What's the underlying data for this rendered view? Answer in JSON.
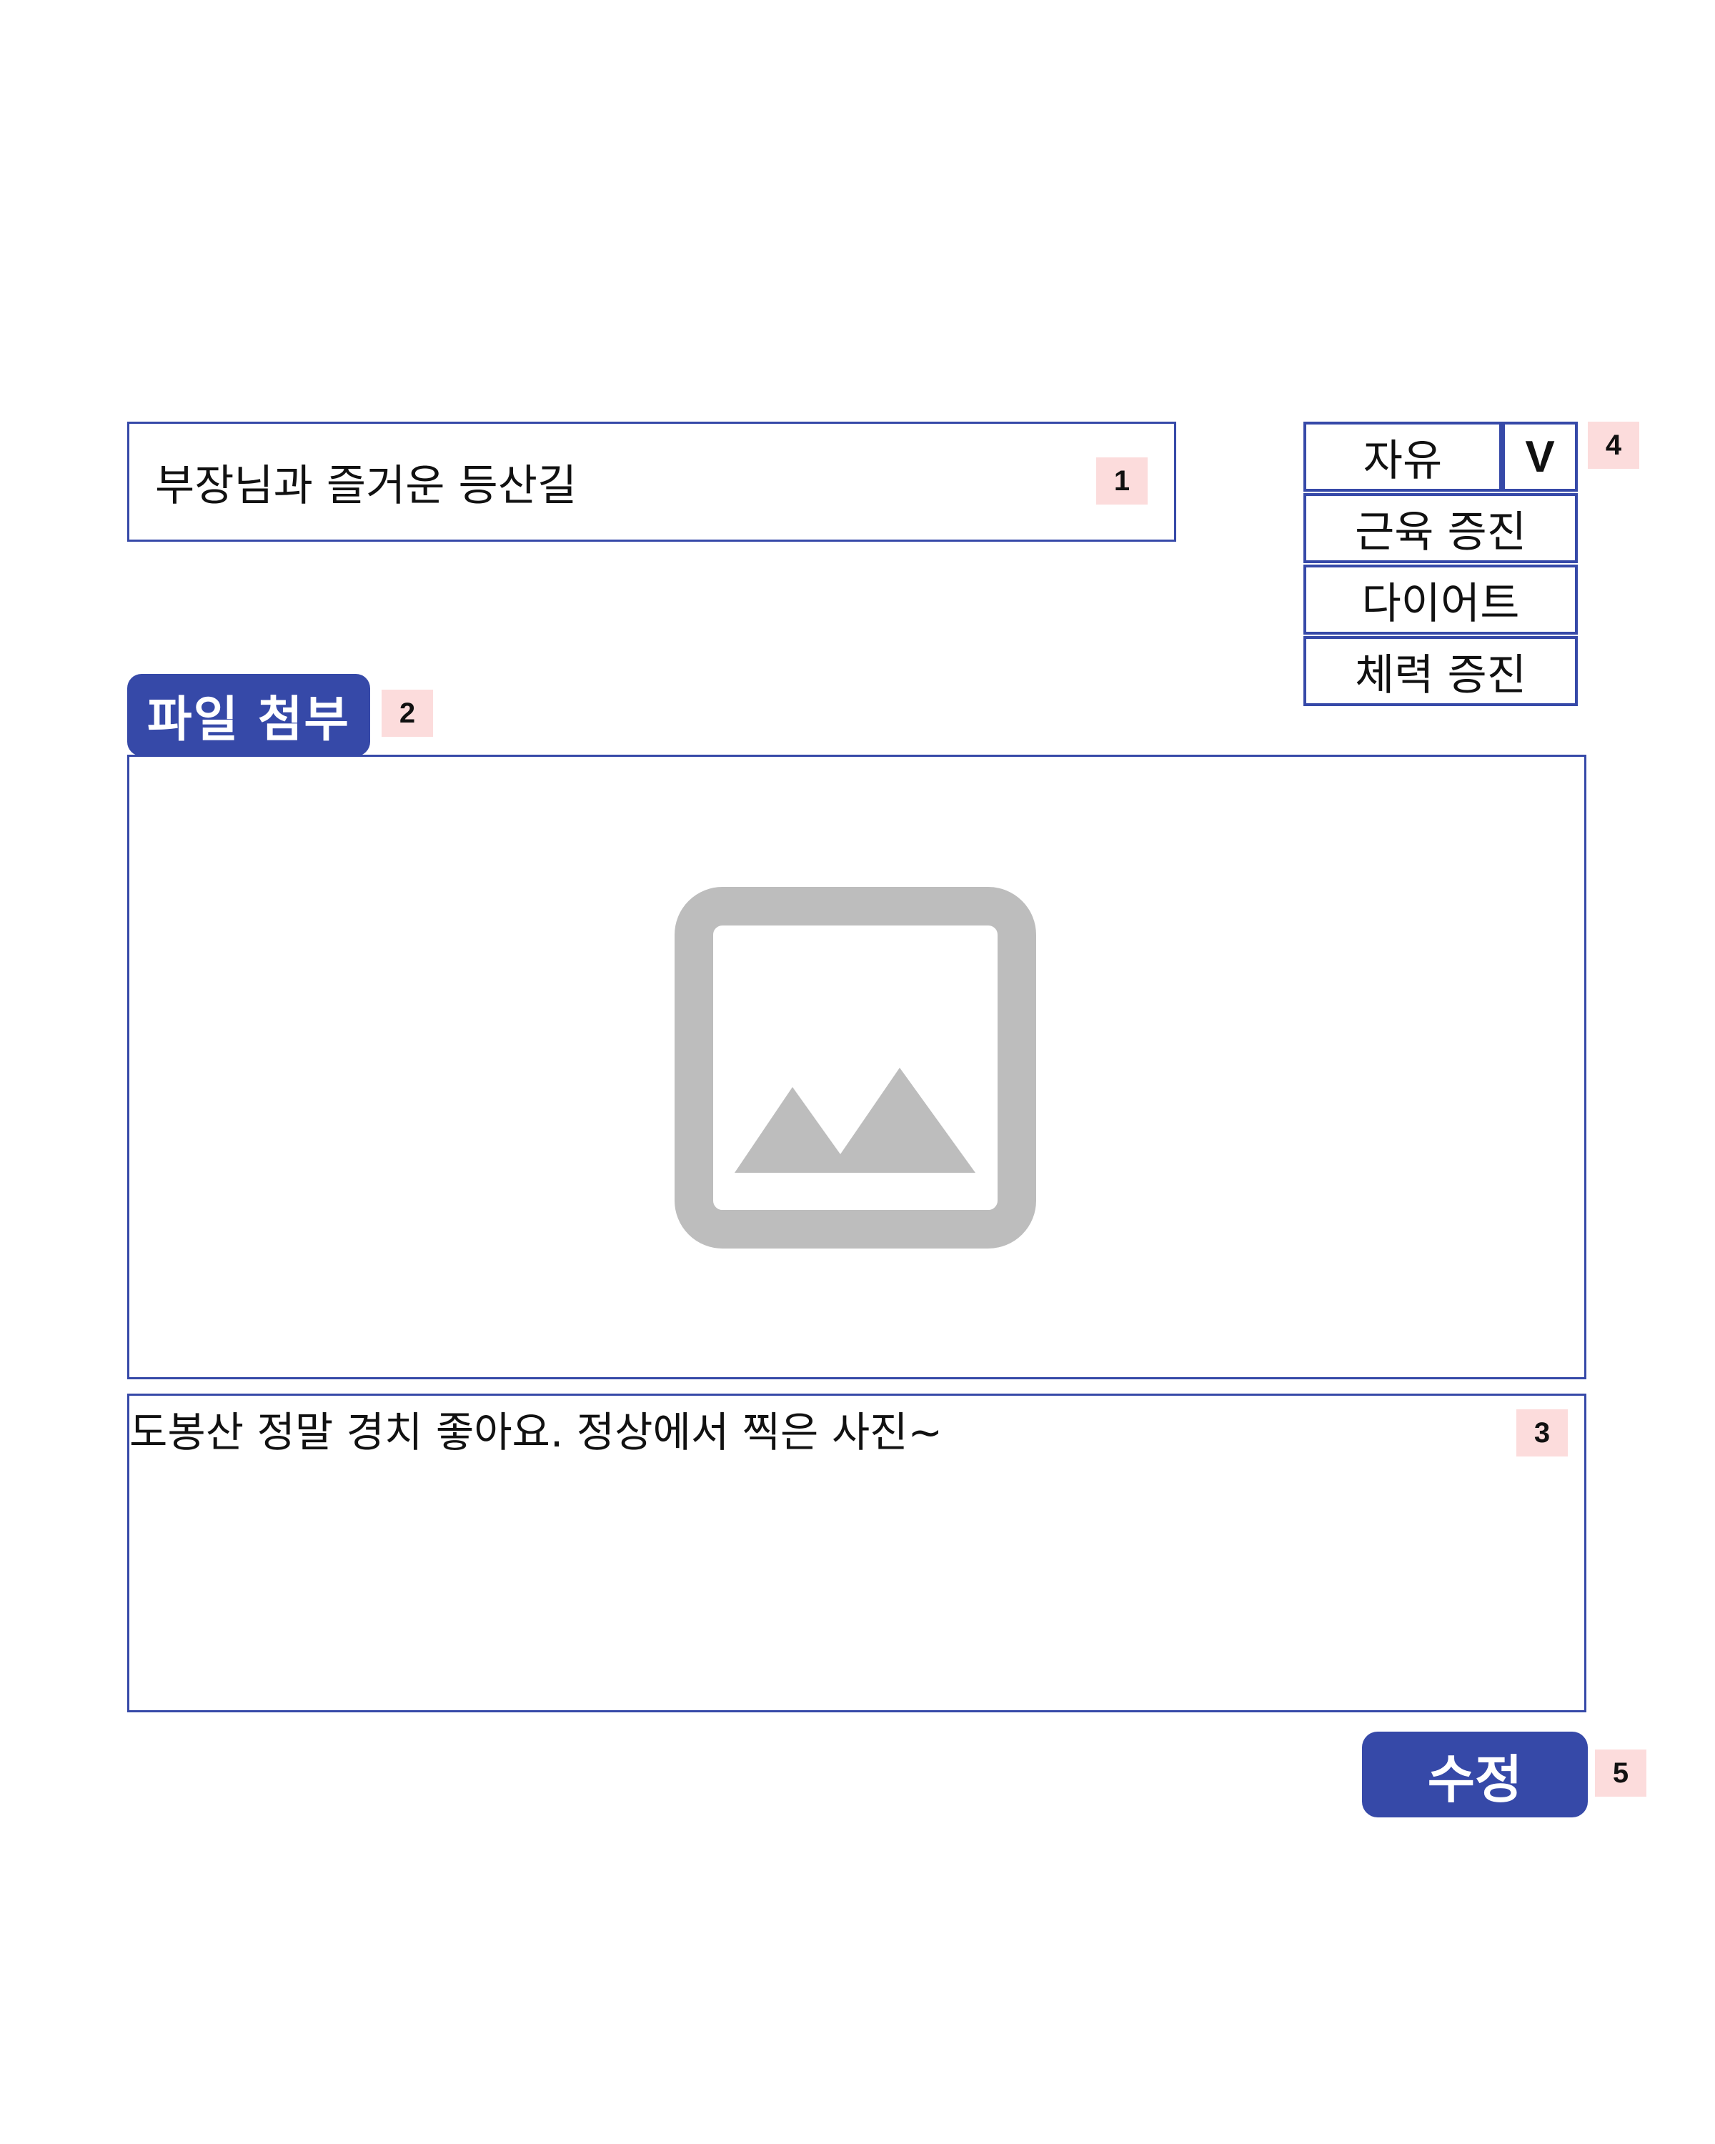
{
  "form": {
    "title_value": "부장님과 즐거운 등산길",
    "attach_label": "파일 첨부",
    "content_value": "도봉산 정말 경치 좋아요. 정상에서 찍은 사진~",
    "submit_label": "수정"
  },
  "category": {
    "selected": "자유",
    "toggle_label": "V",
    "options": [
      "근육 증진",
      "다이어트",
      "체력 증진"
    ]
  },
  "markers": [
    "1",
    "2",
    "3",
    "4",
    "5"
  ],
  "image_placeholder": {
    "icon": "image-icon",
    "color": "#bdbdbd"
  },
  "colors": {
    "accent": "#3649a8",
    "marker_bg": "#fcdcdc"
  }
}
